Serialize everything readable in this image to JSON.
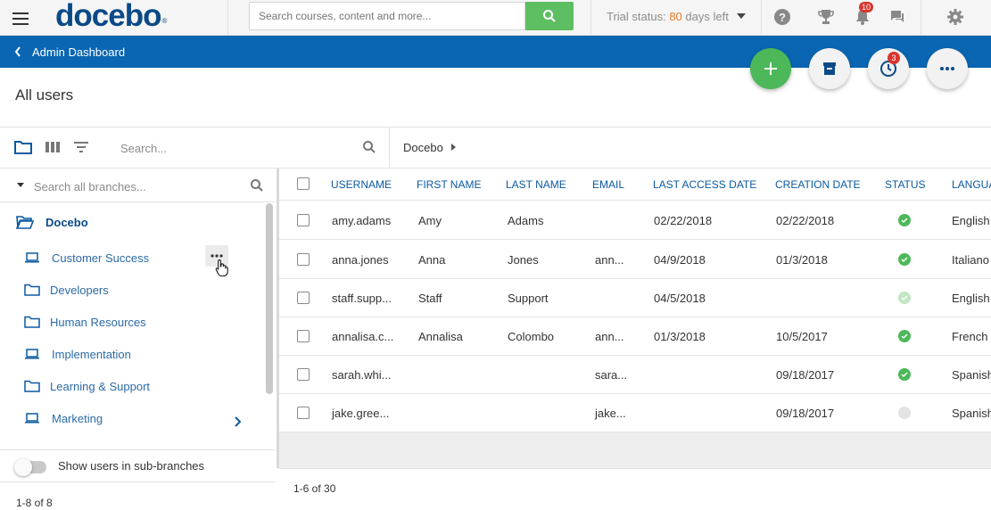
{
  "header": {
    "logo_text": "docebo",
    "logo_mark": "®",
    "search_placeholder": "Search courses, content and more...",
    "trial_prefix": "Trial status: ",
    "trial_days": "80",
    "trial_suffix": " days left",
    "notification_count": "10",
    "icons": [
      "menu-icon",
      "search-icon",
      "help-icon",
      "trophy-icon",
      "bell-icon",
      "chat-icon",
      "gear-icon"
    ]
  },
  "bluebar": {
    "back_label": "Admin Dashboard"
  },
  "fabs": {
    "history_badge": "3",
    "icons": [
      "plus-icon",
      "archive-icon",
      "clock-icon",
      "more-icon"
    ]
  },
  "page": {
    "title": "All users"
  },
  "toolbar": {
    "search_placeholder": "Search...",
    "breadcrumb": "Docebo"
  },
  "tree": {
    "search_placeholder": "Search all branches...",
    "root": "Docebo",
    "items": [
      {
        "label": "Customer Success",
        "icon": "laptop-icon"
      },
      {
        "label": "Developers",
        "icon": "folder-icon"
      },
      {
        "label": "Human Resources",
        "icon": "folder-icon"
      },
      {
        "label": "Implementation",
        "icon": "laptop-icon"
      },
      {
        "label": "Learning & Support",
        "icon": "folder-icon"
      },
      {
        "label": "Marketing",
        "icon": "laptop-icon"
      }
    ],
    "toggle_label": "Show users in sub-branches",
    "count": "1-8 of 8"
  },
  "table": {
    "columns": [
      "USERNAME",
      "FIRST NAME",
      "LAST NAME",
      "EMAIL",
      "LAST ACCESS DATE",
      "CREATION DATE",
      "STATUS",
      "LANGUA"
    ],
    "rows": [
      {
        "username": "amy.adams",
        "first": "Amy",
        "last": "Adams",
        "email": "",
        "last_access": "02/22/2018",
        "created": "02/22/2018",
        "status": "active",
        "language": "English"
      },
      {
        "username": "anna.jones",
        "first": "Anna",
        "last": "Jones",
        "email": "ann...",
        "last_access": "04/9/2018",
        "created": "01/3/2018",
        "status": "active",
        "language": "Italiano"
      },
      {
        "username": "staff.supp...",
        "first": "Staff",
        "last": "Support",
        "email": "",
        "last_access": "04/5/2018",
        "created": "",
        "status": "active-faded",
        "language": "English"
      },
      {
        "username": "annalisa.c...",
        "first": "Annalisa",
        "last": "Colombo",
        "email": "ann...",
        "last_access": "01/3/2018",
        "created": "10/5/2017",
        "status": "active",
        "language": "French"
      },
      {
        "username": "sarah.whi...",
        "first": "",
        "last": "",
        "email": "sara...",
        "last_access": "",
        "created": "09/18/2017",
        "status": "active",
        "language": "Spanish"
      },
      {
        "username": "jake.gree...",
        "first": "",
        "last": "",
        "email": "jake...",
        "last_access": "",
        "created": "09/18/2017",
        "status": "inactive",
        "language": "Spanish"
      }
    ],
    "count": "1-6 of 30"
  },
  "colors": {
    "brand_blue": "#0b4a87",
    "bar_blue": "#0a66b2",
    "link_blue": "#0b5aa2",
    "green": "#4cb85a",
    "badge_red": "#d9352d",
    "trial_orange": "#e57a2a"
  }
}
